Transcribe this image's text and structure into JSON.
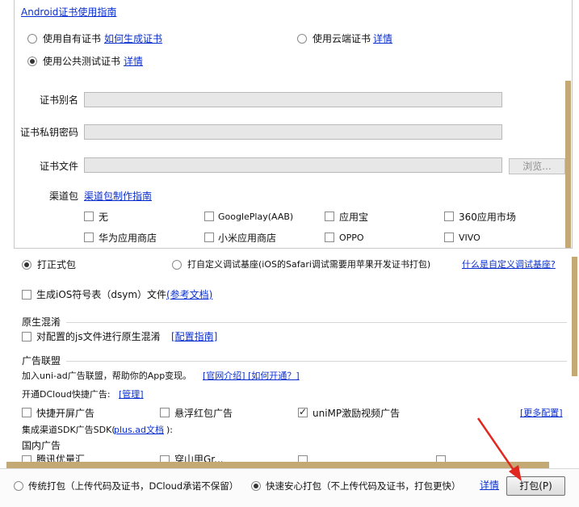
{
  "android_guide_link": "Android证书使用指南",
  "cert_options": {
    "own_cert": "使用自有证书",
    "own_cert_link": "如何生成证书",
    "cloud_cert": "使用云端证书",
    "cloud_cert_link": "详情",
    "public_test_cert": "使用公共测试证书",
    "public_test_cert_link": "详情"
  },
  "fields": {
    "alias_label": "证书别名",
    "alias_value": "",
    "key_password_label": "证书私钥密码",
    "key_password_value": "",
    "cert_file_label": "证书文件",
    "cert_file_value": "",
    "browse_button": "浏览..."
  },
  "channel": {
    "label": "渠道包",
    "guide_link": "渠道包制作指南",
    "items": [
      {
        "label": "无",
        "checked": false
      },
      {
        "label": "GooglePlay(AAB)",
        "checked": false
      },
      {
        "label": "应用宝",
        "checked": false
      },
      {
        "label": "360应用市场",
        "checked": false
      },
      {
        "label": "华为应用商店",
        "checked": false
      },
      {
        "label": "小米应用商店",
        "checked": false
      },
      {
        "label": "OPPO",
        "checked": false
      },
      {
        "label": "VIVO",
        "checked": false
      }
    ]
  },
  "build_type": {
    "formal": "打正式包",
    "custom_base": "打自定义调试基座(iOS的Safari调试需要用苹果开发证书打包)",
    "custom_base_link": "什么是自定义调试基座?",
    "selected": "formal"
  },
  "dsym": {
    "label": "生成iOS符号表（dsym）文件",
    "link": "(参考文档)",
    "checked": false
  },
  "native_obfuscation": {
    "title": "原生混淆",
    "label": "对配置的js文件进行原生混淆",
    "link": "[配置指南]",
    "checked": false
  },
  "ad_alliance": {
    "title": "广告联盟",
    "intro": "加入uni-ad广告联盟，帮助你的App变现。",
    "intro_links": "[官网介绍] [如何开通？]",
    "dcloud_label": "开通DCloud快捷广告:",
    "dcloud_manage_link": "[管理]",
    "options": [
      {
        "label": "快捷开屏广告",
        "checked": false
      },
      {
        "label": "悬浮红包广告",
        "checked": false
      },
      {
        "label": "uniMP激励视频广告",
        "checked": true
      }
    ],
    "more_link": "[更多配置]",
    "sdk_label_prefix": "集成渠道SDK广告SDK(",
    "sdk_link": "plus.ad文档",
    "sdk_label_suffix": "):",
    "domestic_label": "国内广告",
    "domestic_items_partial": [
      "腾讯优量汇",
      "穿山甲Gr..."
    ]
  },
  "footer": {
    "traditional": "传统打包（上传代码及证书，DCloud承诺不保留）",
    "fast": "快速安心打包（不上传代码及证书，打包更快）",
    "detail_link": "详情",
    "pack_button": "打包(P)",
    "selected": "fast"
  },
  "colors": {
    "link": "#0a2fd0",
    "scrollbar": "#c4a974",
    "arrow": "#e0281e"
  }
}
